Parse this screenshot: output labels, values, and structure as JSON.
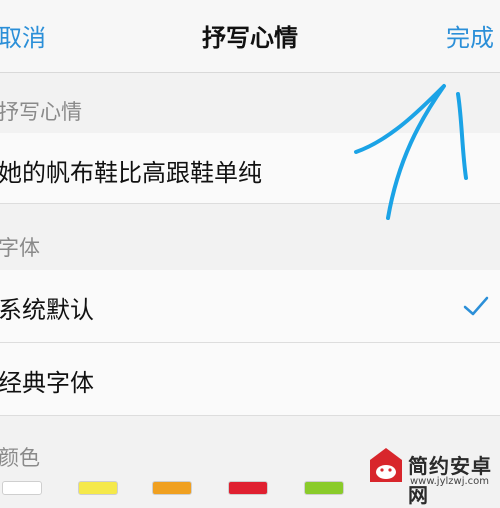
{
  "navbar": {
    "cancel_label": "取消",
    "title": "抒写心情",
    "done_label": "完成"
  },
  "mood_section": {
    "label": "抒写心情",
    "text": "她的帆布鞋比高跟鞋单纯"
  },
  "font_section": {
    "label": "字体",
    "options": [
      {
        "label": "系统默认",
        "selected": true
      },
      {
        "label": "经典字体",
        "selected": false
      }
    ]
  },
  "color_section": {
    "label": "颜色",
    "swatches": [
      "#ffffff",
      "#f5e94a",
      "#f0a020",
      "#e02030",
      "#8acb2a"
    ]
  },
  "watermark": {
    "name": "简约安卓网",
    "url": "www.jylzwj.com"
  },
  "accent_color": "#2b8fd8"
}
